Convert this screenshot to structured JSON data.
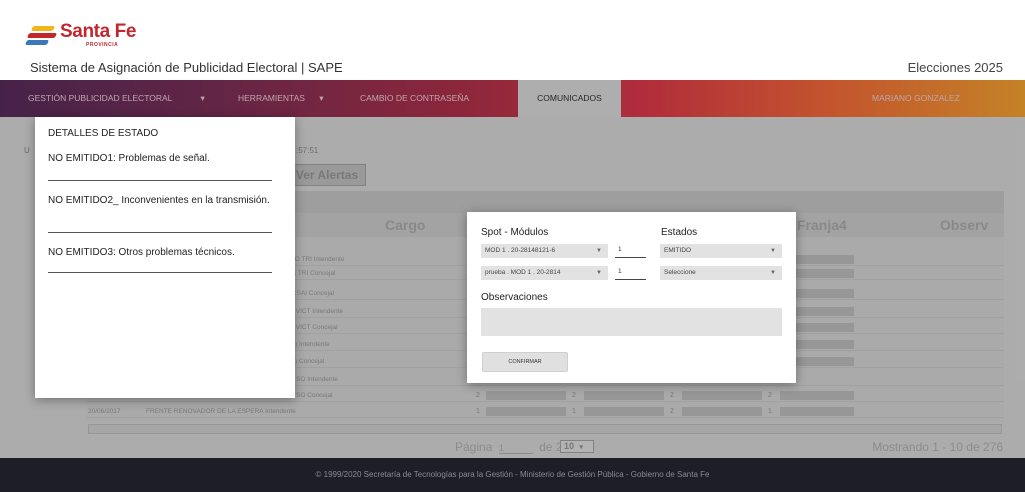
{
  "header": {
    "logo_text": "Santa Fe",
    "logo_subtext": "PROVINCIA",
    "app_title": "Sistema de Asignación de Publicidad Electoral | SAPE",
    "elections_label": "Elecciones 2025"
  },
  "colors": {
    "brand_red": "#c0282e",
    "nav_gradient_start": "#4a1a4e",
    "nav_gradient_end": "#f39a1f",
    "footer_bg": "#1e1e26"
  },
  "nav": {
    "items": [
      {
        "label": "GESTIÓN PUBLICIDAD ELECTORAL",
        "caret": "▾"
      },
      {
        "label": "HERRAMIENTAS",
        "caret": "▾"
      },
      {
        "label": "CAMBIO DE CONTRASEÑA"
      },
      {
        "label": "COMUNICADOS"
      }
    ],
    "user_label": "MARIANO GONZALEZ"
  },
  "background": {
    "user_prefix": "U",
    "time_fragment": ":57:51",
    "alerts_button": "Ver Alertas",
    "columns": [
      "Cargo",
      "Franja4",
      "Observ"
    ],
    "rows": [
      {
        "cargo": "DO TRI Intendente"
      },
      {
        "cargo": "IS TRI Concejal"
      },
      {
        "cargo": "ICSAI Concejal"
      },
      {
        "cargo": "A VICT Intendente"
      },
      {
        "cargo": "A VICT Concejal"
      },
      {
        "cargo": "O)     Intendente"
      },
      {
        "cargo": "O)     Concejal"
      },
      {
        "cargo": "Y SO Intendente"
      },
      {
        "cargo": "Y SO Concejal",
        "nums": [
          "2",
          "2",
          "2",
          "2"
        ]
      },
      {
        "date": "20/06/2017",
        "cargo": "FRENTE RENOVADOR DE LA ESPERA Intendente",
        "nums": [
          "1",
          "1",
          "2",
          "1"
        ]
      }
    ],
    "pager": {
      "page_label": "Página",
      "page_value": "1",
      "of_label": "de 28",
      "page_size": "10",
      "showing": "Mostrando 1 - 10 de 276"
    }
  },
  "footer": {
    "text": "© 1999/2020 Secretaría de Tecnologías para la Gestión - Ministerio de Gestión Pública - Gobierno de Santa Fe"
  },
  "status_panel": {
    "title": "DETALLES DE ESTADO",
    "items": [
      "NO EMITIDO1: Problemas de señal.",
      "NO EMITIDO2_ Inconvenientes en la transmisión.",
      "NO EMITIDO3: Otros problemas técnicos."
    ]
  },
  "spot_modal": {
    "spot_label": "Spot - Módulos",
    "estados_label": "Estados",
    "rows": [
      {
        "spot": "MOD 1 . 20-28148121-6",
        "qty": "1",
        "estado": "EMITIDO"
      },
      {
        "spot": "prueba . MOD 1 . 20-2814",
        "qty": "1",
        "estado": "Seleccione"
      }
    ],
    "observaciones_label": "Observaciones",
    "observaciones_value": "",
    "confirm_label": "CONFIRMAR"
  }
}
